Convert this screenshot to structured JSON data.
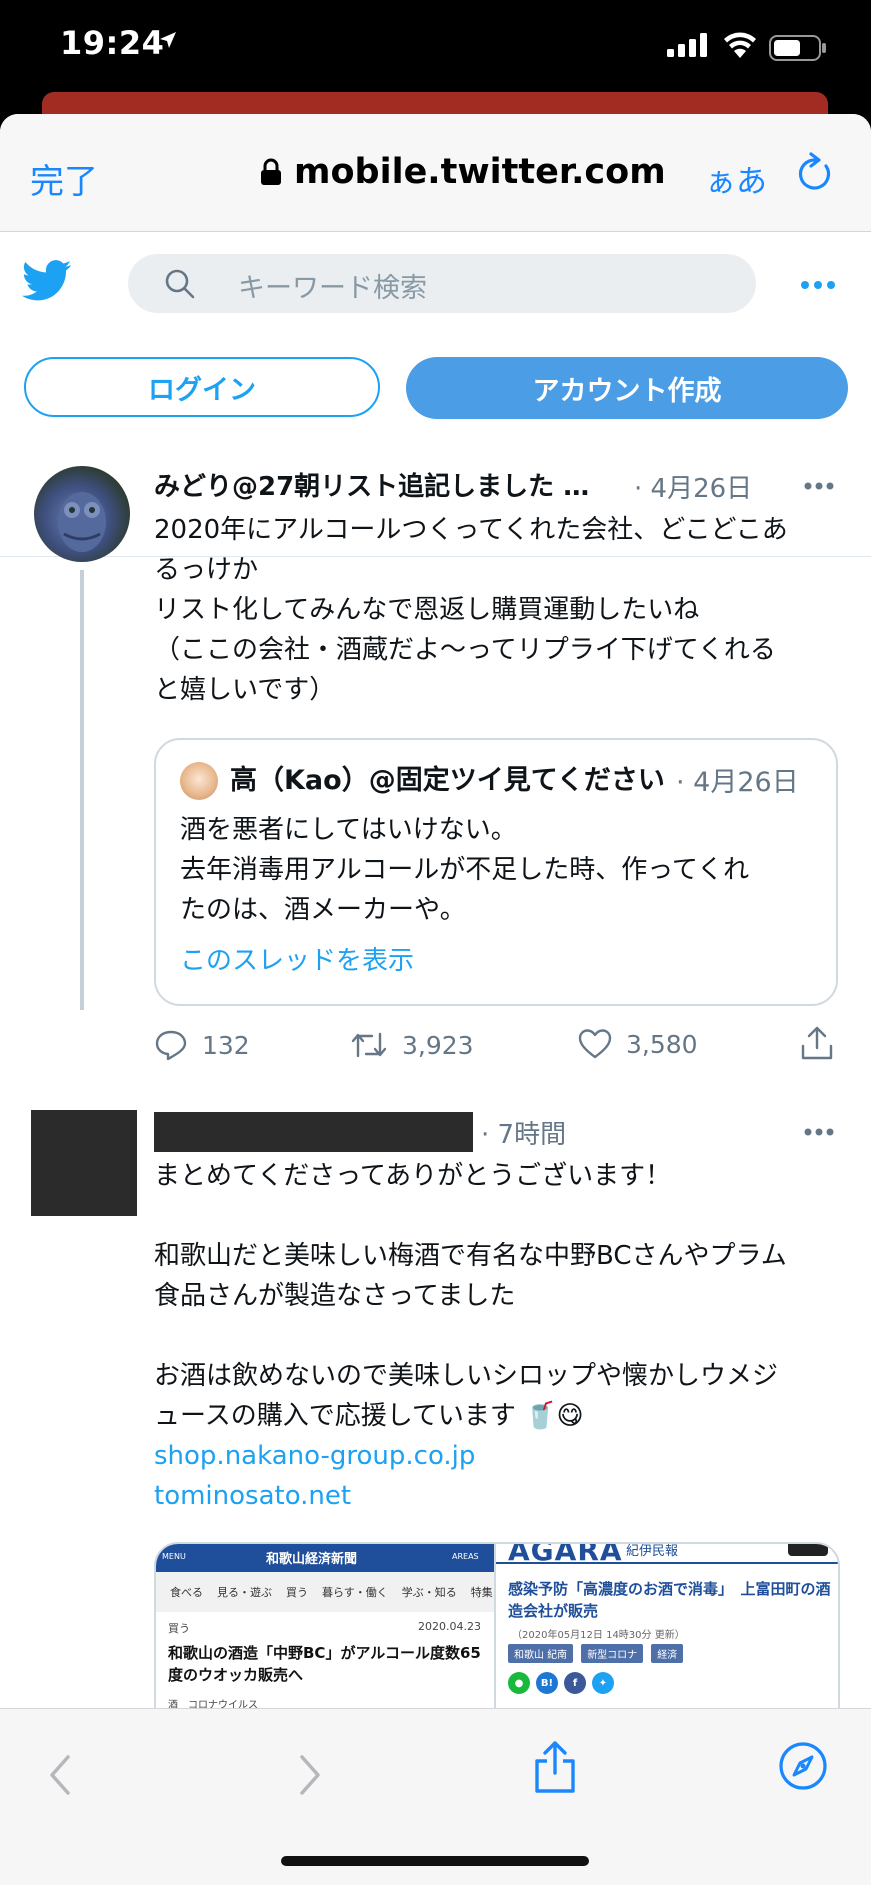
{
  "status_bar": {
    "time": "19:24"
  },
  "browser": {
    "done_label": "完了",
    "url": "mobile.twitter.com",
    "text_size_label": "ぁあ"
  },
  "twitter_header": {
    "search_placeholder": "キーワード検索",
    "login_label": "ログイン",
    "signup_label": "アカウント作成"
  },
  "tweet": {
    "author": "みどり@27朝リスト追記しました …",
    "date": "· 4月26日",
    "lines": [
      "2020年にアルコールつくってくれた会社、どこどこあ",
      "るっけか",
      "リスト化してみんなで恩返し購買運動したいね",
      "（ここの会社・酒蔵だよ〜ってリプライ下げてくれる",
      "と嬉しいです）"
    ],
    "quote": {
      "author": "高（Kao）@固定ツイ見てください（",
      "date": "· 4月26日",
      "lines": [
        "酒を悪者にしてはいけない。",
        "去年消毒用アルコールが不足した時、作ってくれ",
        "たのは、酒メーカーや。"
      ],
      "thread_link": "このスレッドを表示"
    },
    "stats": {
      "replies": "132",
      "retweets": "3,923",
      "likes": "3,580"
    }
  },
  "reply": {
    "date": "· 7時間",
    "lines": [
      "まとめてくださってありがとうございます！",
      "",
      "和歌山だと美味しい梅酒で有名な中野BCさんやプラム",
      "食品さんが製造なさってました",
      "",
      "お酒は飲めないので美味しいシロップや懐かしウメジ",
      "ュースの購入で応援しています 🥤😋"
    ],
    "links": [
      "shop.nakano-group.co.jp",
      "tominosato.net"
    ]
  },
  "image_left": {
    "masthead": "和歌山経済新聞",
    "menu_label": "MENU",
    "areas_label": "AREAS",
    "nav": [
      "食べる",
      "見る・遊ぶ",
      "買う",
      "暮らす・働く",
      "学ぶ・知る",
      "特集"
    ],
    "category": "買う",
    "date": "2020.04.23",
    "headline": "和歌山の酒造「中野BC」がアルコール度数65度のウオッカ販売へ",
    "tags": "酒　コロナウイルス"
  },
  "image_right": {
    "brand": "AGARA",
    "brand_sub": "紀伊民報",
    "headline": "感染予防「高濃度のお酒で消毒」　上富田町の酒造会社が販売",
    "meta": "（2020年05月12日 14時30分 更新）",
    "chips": [
      "和歌山 紀南",
      "新型コロナ",
      "経済"
    ],
    "social": [
      "B!",
      "f"
    ]
  },
  "colors": {
    "twitter_blue": "#1da1f2",
    "ios_blue": "#1a87ff",
    "signup_fill": "#4b9ee6"
  }
}
